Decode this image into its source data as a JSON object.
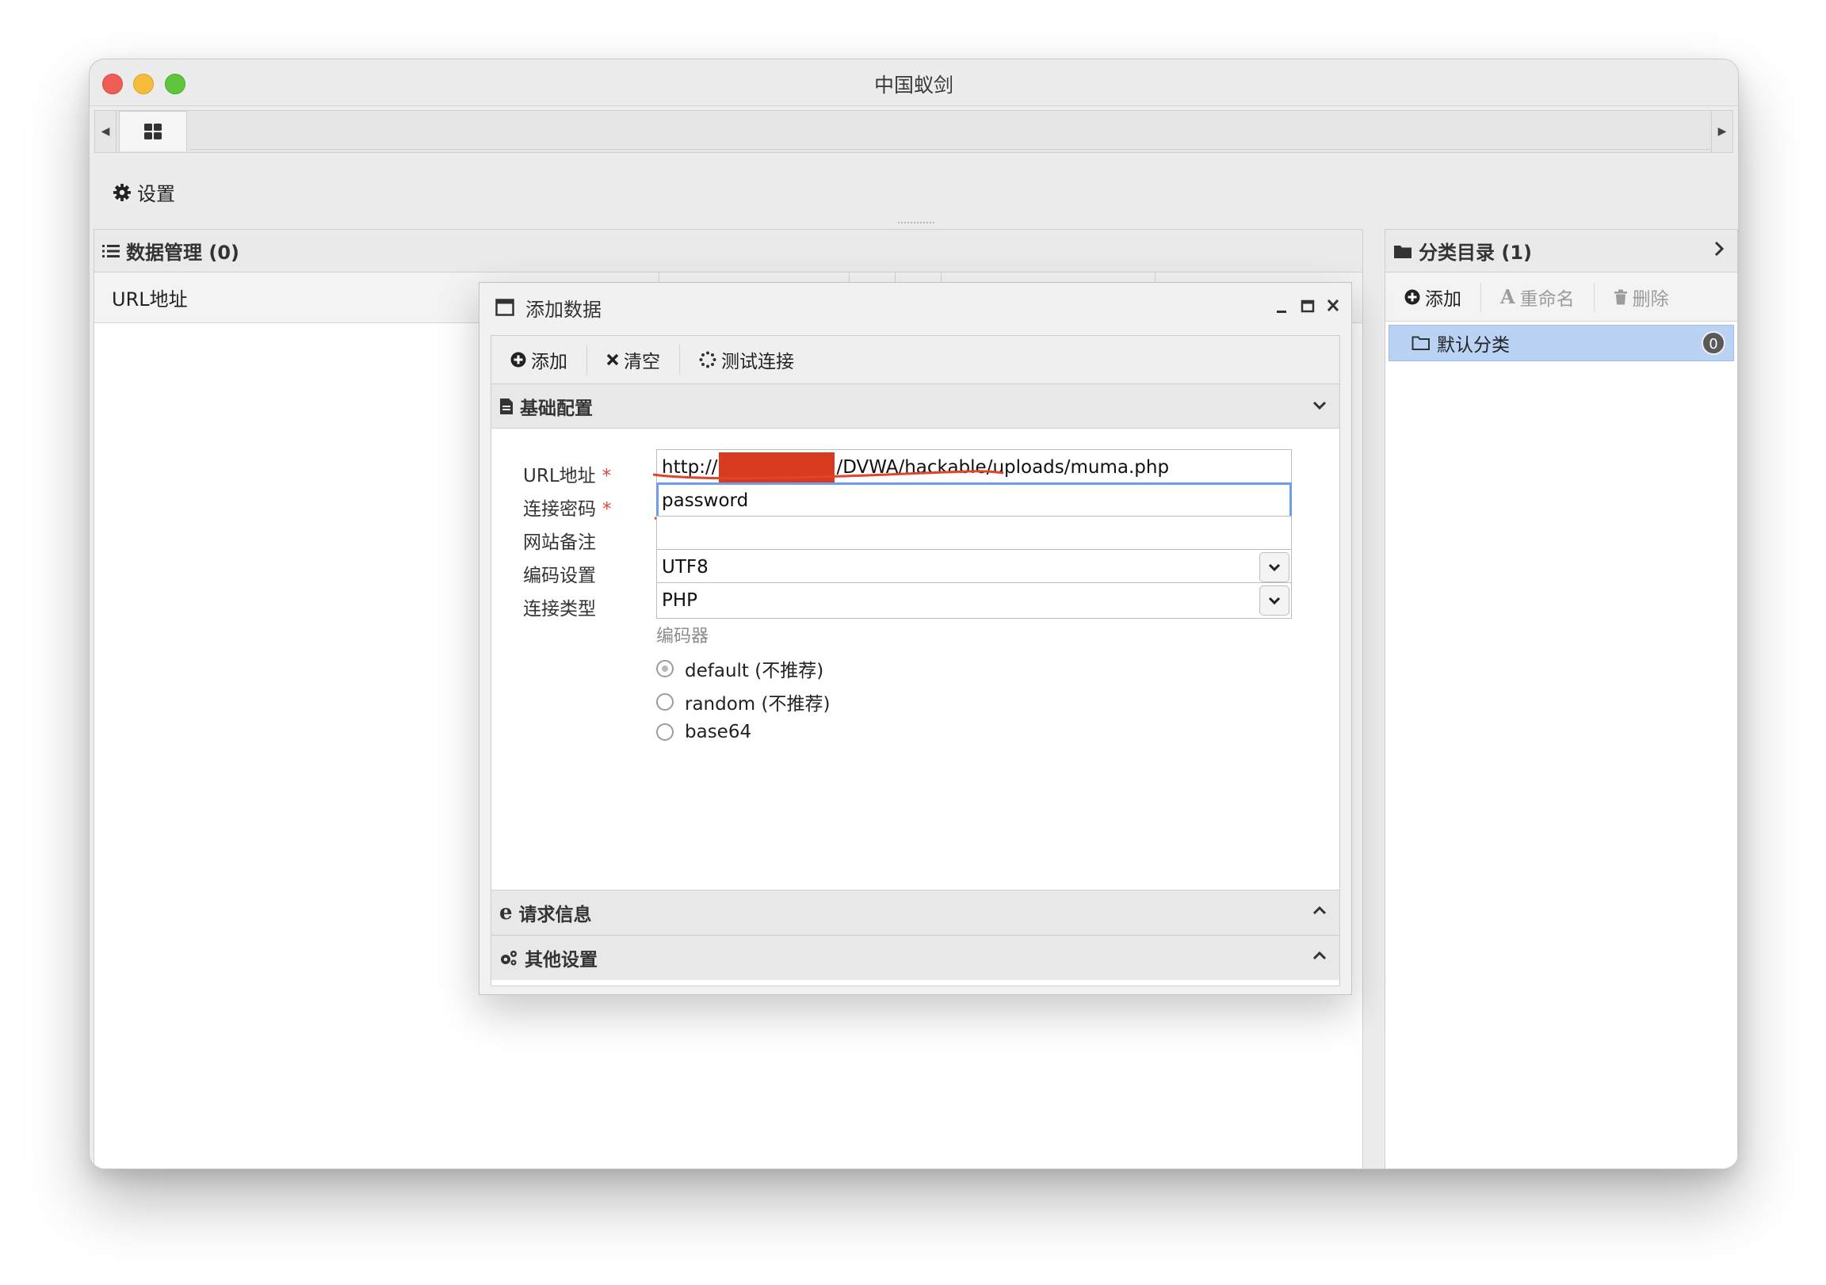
{
  "window": {
    "title": "中国蚁剑"
  },
  "toolbar": {
    "settings_label": "设置"
  },
  "data_panel": {
    "title": "数据管理 (0)",
    "columns": [
      "URL地址"
    ]
  },
  "category_panel": {
    "title": "分类目录 (1)",
    "add_label": "添加",
    "rename_label": "重命名",
    "delete_label": "删除",
    "items": [
      {
        "label": "默认分类",
        "count": "0"
      }
    ]
  },
  "dialog": {
    "title": "添加数据",
    "toolbar": {
      "add_label": "添加",
      "clear_label": "清空",
      "test_label": "测试连接"
    },
    "sections": {
      "basic": "基础配置",
      "request": "请求信息",
      "other": "其他设置"
    },
    "fields": {
      "url_label": "URL地址",
      "url_prefix": "http://",
      "url_suffix": "/DVWA/hackable/uploads/muma.php",
      "password_label": "连接密码",
      "password_value": "password",
      "note_label": "网站备注",
      "note_value": "",
      "encoding_label": "编码设置",
      "encoding_value": "UTF8",
      "type_label": "连接类型",
      "type_value": "PHP",
      "required_mark": "*"
    },
    "encoder": {
      "label": "编码器",
      "options": [
        "default (不推荐)",
        "random (不推荐)",
        "base64"
      ],
      "selected": "default (不推荐)"
    }
  },
  "colors": {
    "accent_selected": "#bad3f4",
    "focus_border": "#6ea0e8",
    "required": "#e0443b",
    "redaction": "#d83b1f",
    "annotation": "#e0442a"
  },
  "icons": [
    "grid-icon",
    "gear-icon",
    "list-icon",
    "folder-icon",
    "plus-circle-icon",
    "font-icon",
    "trash-icon",
    "folder-open-icon",
    "window-icon",
    "minimize-icon",
    "maximize-icon",
    "close-icon",
    "times-icon",
    "spinner-icon",
    "file-icon",
    "chevron-down-icon",
    "chevron-up-icon",
    "ie-icon",
    "gears-icon",
    "chevron-right-icon",
    "caret-left-icon",
    "caret-right-icon"
  ]
}
